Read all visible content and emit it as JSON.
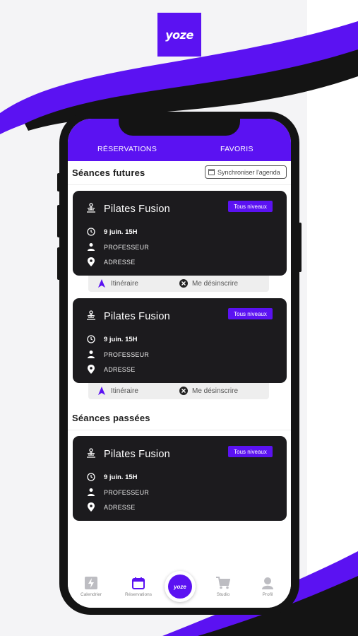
{
  "brand": {
    "logo_text": "yoze",
    "accent": "#5b12f2"
  },
  "tabs": {
    "reservations": "RÉSERVATIONS",
    "favorites": "FAVORIS"
  },
  "future": {
    "title": "Séances futures",
    "sync_label": "Synchroniser l'agenda",
    "cards": [
      {
        "name": "Pilates Fusion",
        "level": "Tous niveaux",
        "date": "9 juin. 15H",
        "teacher": "PROFESSEUR",
        "address": "ADRESSE",
        "itinerary": "Itinéraire",
        "unsubscribe": "Me désinscrire"
      },
      {
        "name": "Pilates Fusion",
        "level": "Tous niveaux",
        "date": "9 juin. 15H",
        "teacher": "PROFESSEUR",
        "address": "ADRESSE",
        "itinerary": "Itinéraire",
        "unsubscribe": "Me désinscrire"
      }
    ]
  },
  "past": {
    "title": "Séances passées",
    "cards": [
      {
        "name": "Pilates Fusion",
        "level": "Tous niveaux",
        "date": "9 juin. 15H",
        "teacher": "PROFESSEUR",
        "address": "ADRESSE"
      }
    ]
  },
  "nav": {
    "calendar": "Calendrier",
    "reservations": "Réservations",
    "center": "yoze",
    "studio": "Studio",
    "profile": "Profil"
  },
  "icons": [
    "meditation-icon",
    "clock-icon",
    "person-icon",
    "location-pin-icon",
    "navigation-arrow-icon",
    "cancel-icon",
    "calendar-icon",
    "lightning-icon",
    "cart-icon",
    "profile-icon"
  ]
}
